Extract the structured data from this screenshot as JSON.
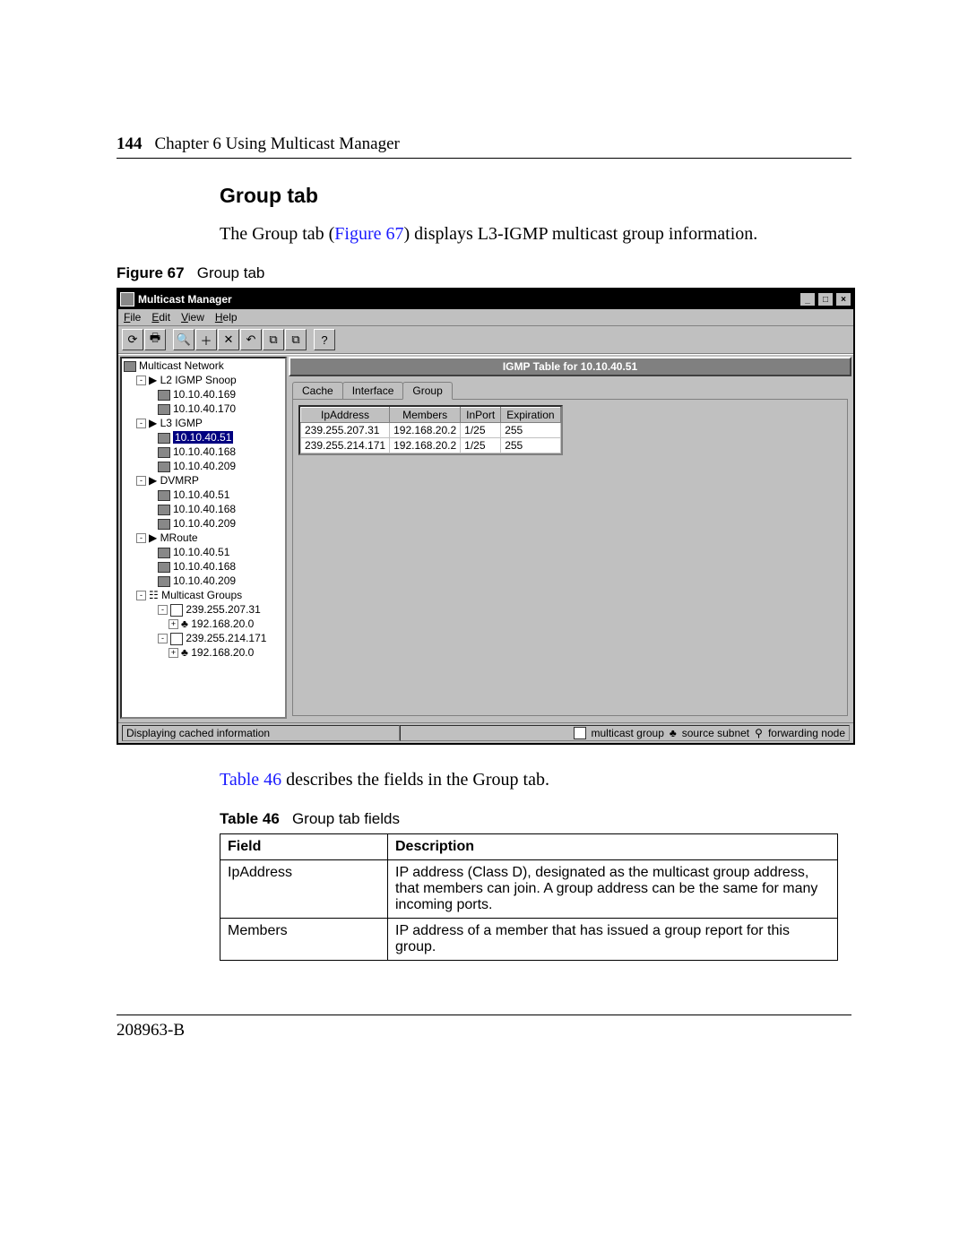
{
  "page": {
    "number": "144",
    "chapter": "Chapter 6  Using Multicast Manager",
    "docnum": "208963-B"
  },
  "section_title": "Group tab",
  "intro_pre": "The Group tab (",
  "intro_link": "Figure 67",
  "intro_post": ") displays L3-IGMP multicast group information.",
  "fig_label": "Figure 67",
  "fig_title": "Group tab",
  "app": {
    "title": "Multicast Manager",
    "menus": {
      "file": "File",
      "edit": "Edit",
      "view": "View",
      "help": "Help"
    },
    "panel_title": "IGMP Table for 10.10.40.51",
    "tabs": {
      "cache": "Cache",
      "interface": "Interface",
      "group": "Group"
    },
    "status_left": "Displaying cached information",
    "legend": {
      "mg": "multicast group",
      "ss": "source subnet",
      "fn": "forwarding node"
    }
  },
  "tree": {
    "root": "Multicast Network",
    "l2": "L2 IGMP Snoop",
    "l2_a": "10.10.40.169",
    "l2_b": "10.10.40.170",
    "l3": "L3 IGMP",
    "l3_a": "10.10.40.51",
    "l3_b": "10.10.40.168",
    "l3_c": "10.10.40.209",
    "dvmrp": "DVMRP",
    "dv_a": "10.10.40.51",
    "dv_b": "10.10.40.168",
    "dv_c": "10.10.40.209",
    "mroute": "MRoute",
    "mr_a": "10.10.40.51",
    "mr_b": "10.10.40.168",
    "mr_c": "10.10.40.209",
    "mg": "Multicast Groups",
    "g1": "239.255.207.31",
    "g1a": "192.168.20.0",
    "g2": "239.255.214.171",
    "g2a": "192.168.20.0"
  },
  "igmp": {
    "h_ip": "IpAddress",
    "h_mem": "Members",
    "h_in": "InPort",
    "h_exp": "Expiration",
    "r1": {
      "ip": "239.255.207.31",
      "mem": "192.168.20.2",
      "in": "1/25",
      "exp": "255"
    },
    "r2": {
      "ip": "239.255.214.171",
      "mem": "192.168.20.2",
      "in": "1/25",
      "exp": "255"
    }
  },
  "table_ref_pre": "",
  "table_ref_link": "Table 46",
  "table_ref_post": " describes the fields in the Group tab.",
  "tbl_label": "Table 46",
  "tbl_title": "Group tab fields",
  "tbl": {
    "h_field": "Field",
    "h_desc": "Description",
    "r1_f": "IpAddress",
    "r1_d": "IP address (Class D), designated as the multicast group address, that members can join. A group address can be the same for many incoming ports.",
    "r2_f": "Members",
    "r2_d": "IP address of a member that has issued a group report for this group."
  }
}
